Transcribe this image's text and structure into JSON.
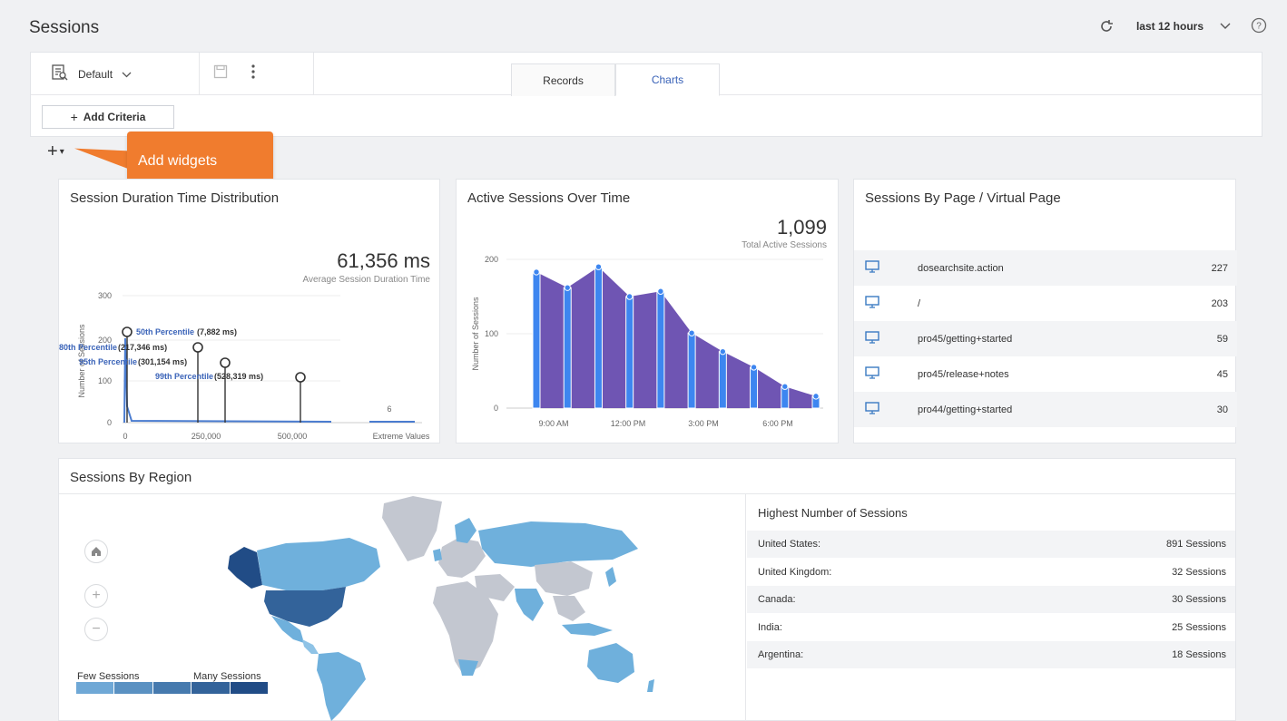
{
  "header": {
    "title": "Sessions",
    "time_range": "last 12 hours",
    "refresh_icon": "refresh-icon",
    "help_icon": "help-icon"
  },
  "query_bar": {
    "view_name": "Default",
    "tabs": [
      {
        "label": "Records",
        "active": false
      },
      {
        "label": "Charts",
        "active": true
      }
    ],
    "add_criteria": "Add Criteria"
  },
  "widgets": {
    "add_icon": "+",
    "tooltip": "Add widgets"
  },
  "duration_card": {
    "title": "Session Duration Time Distribution",
    "value": "61,356 ms",
    "subtitle": "Average Session Duration Time",
    "ylabel": "Number of Sessions",
    "yticks": [
      "300",
      "200",
      "100",
      "0"
    ],
    "xticks": [
      "0",
      "250,000",
      "500,000",
      "Extreme Values"
    ],
    "extreme_count": "6",
    "percentiles": [
      {
        "label": "50th Percentile",
        "value": "(7,882 ms)"
      },
      {
        "label": "80th Percentile",
        "value": "(217,346 ms)"
      },
      {
        "label": "95th Percentile",
        "value": "(301,154 ms)"
      },
      {
        "label": "99th Percentile",
        "value": "(528,319 ms)"
      }
    ]
  },
  "active_card": {
    "title": "Active Sessions Over Time",
    "value": "1,099",
    "subtitle": "Total Active Sessions",
    "ylabel": "Number of Sessions",
    "yticks": [
      "200",
      "100",
      "0"
    ],
    "xticks": [
      "9:00 AM",
      "12:00 PM",
      "3:00 PM",
      "6:00 PM"
    ]
  },
  "chart_data": {
    "type": "bar",
    "title": "Active Sessions Over Time",
    "ylabel": "Number of Sessions",
    "ylim": [
      0,
      200
    ],
    "values": [
      183,
      162,
      190,
      150,
      157,
      101,
      76,
      55,
      29,
      16
    ],
    "xtick_labels": [
      "9:00 AM",
      "12:00 PM",
      "3:00 PM",
      "6:00 PM"
    ]
  },
  "pages_card": {
    "title": "Sessions By Page / Virtual Page",
    "rows": [
      {
        "name": "dosearchsite.action",
        "count": "227"
      },
      {
        "name": "/",
        "count": "203"
      },
      {
        "name": "pro45/getting+started",
        "count": "59"
      },
      {
        "name": "pro45/release+notes",
        "count": "45"
      },
      {
        "name": "pro44/getting+started",
        "count": "30"
      }
    ]
  },
  "region_card": {
    "title": "Sessions By Region",
    "table_title": "Highest Number of Sessions",
    "rows": [
      {
        "country": "United States:",
        "sessions": "891 Sessions"
      },
      {
        "country": "United Kingdom:",
        "sessions": "32 Sessions"
      },
      {
        "country": "Canada:",
        "sessions": "30 Sessions"
      },
      {
        "country": "India:",
        "sessions": "25 Sessions"
      },
      {
        "country": "Argentina:",
        "sessions": "18 Sessions"
      }
    ],
    "legend_low": "Few Sessions",
    "legend_high": "Many Sessions",
    "legend_colors": [
      "#6fa8d6",
      "#5a91c2",
      "#467aae",
      "#33639a",
      "#214c86"
    ]
  }
}
